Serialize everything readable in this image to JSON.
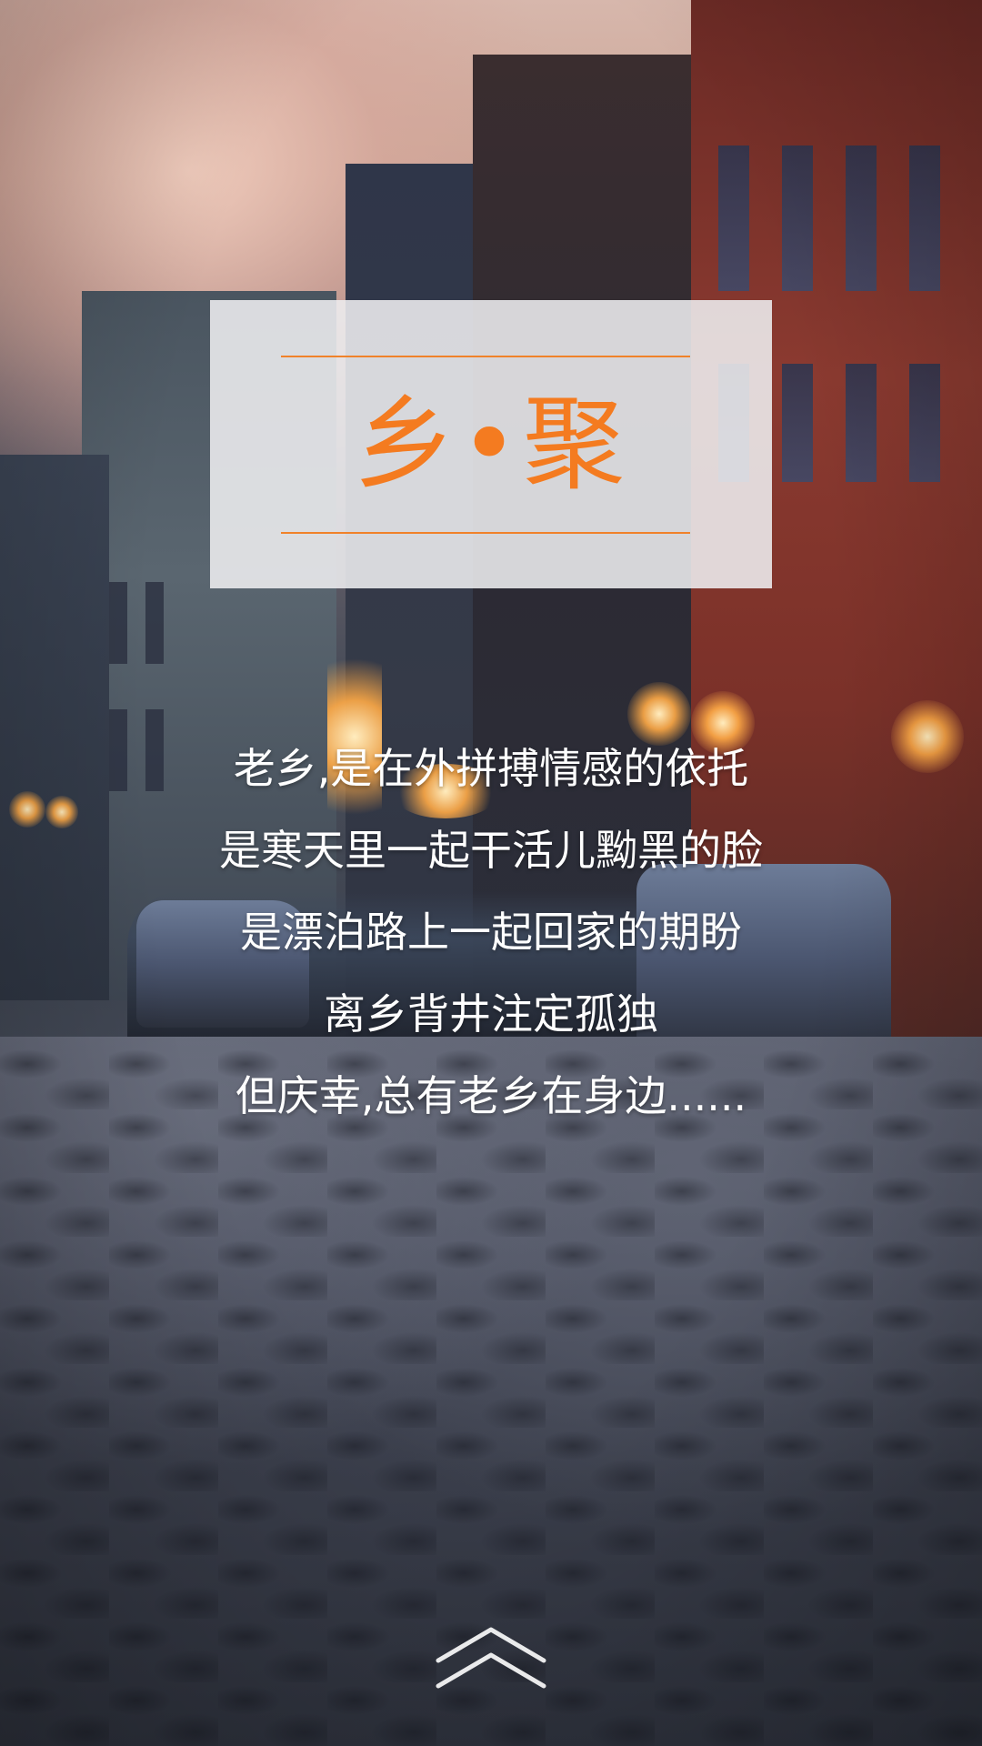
{
  "title": {
    "text": "乡•聚",
    "line_color": "#f0822a",
    "text_color": "#f47b20",
    "card_color": "#eeeef0"
  },
  "poem": {
    "lines": [
      "老乡,是在外拼搏情感的依托",
      "是寒天里一起干活儿黝黑的脸",
      "是漂泊路上一起回家的期盼",
      "离乡背井注定孤独",
      "但庆幸,总有老乡在身边......"
    ],
    "text_color": "#ffffff"
  },
  "navigation": {
    "swipe_up_icon": "double-chevron-up-icon"
  }
}
